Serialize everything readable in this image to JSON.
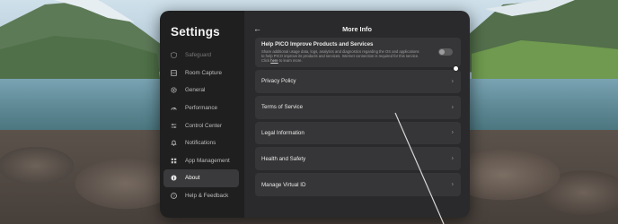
{
  "sidebar": {
    "title": "Settings",
    "items": [
      {
        "label": "Safeguard",
        "icon": "shield-icon",
        "faded": true
      },
      {
        "label": "Room Capture",
        "icon": "room-icon",
        "faded": false
      },
      {
        "label": "General",
        "icon": "gear-icon",
        "faded": false
      },
      {
        "label": "Performance",
        "icon": "performance-icon",
        "faded": false
      },
      {
        "label": "Control Center",
        "icon": "control-center-icon",
        "faded": false
      },
      {
        "label": "Notifications",
        "icon": "bell-icon",
        "faded": false
      },
      {
        "label": "App Management",
        "icon": "apps-icon",
        "faded": false
      },
      {
        "label": "About",
        "icon": "info-icon",
        "faded": false,
        "active": true
      },
      {
        "label": "Help & Feedback",
        "icon": "help-icon",
        "faded": false
      }
    ]
  },
  "header": {
    "back_icon": "back-arrow-icon",
    "title": "More Info"
  },
  "improve": {
    "title": "Help PICO Improve Products and Services",
    "description": "Share additional usage data, logs, analytics and diagnostics regarding the OS and applications to help PICO improve its products and services. Internet connection is required for this service. Click",
    "link_text": "here",
    "description_tail": "to learn more.",
    "toggle_on": false
  },
  "items": [
    {
      "label": "Privacy Policy"
    },
    {
      "label": "Terms of Service"
    },
    {
      "label": "Legal Information"
    },
    {
      "label": "Health and Safety"
    },
    {
      "label": "Manage Virtual ID"
    }
  ],
  "colors": {
    "panel_bg": "#2a2a2c",
    "sidebar_bg": "#1f1f20",
    "card_bg": "#363638",
    "active_bg": "#3a3a3c"
  }
}
